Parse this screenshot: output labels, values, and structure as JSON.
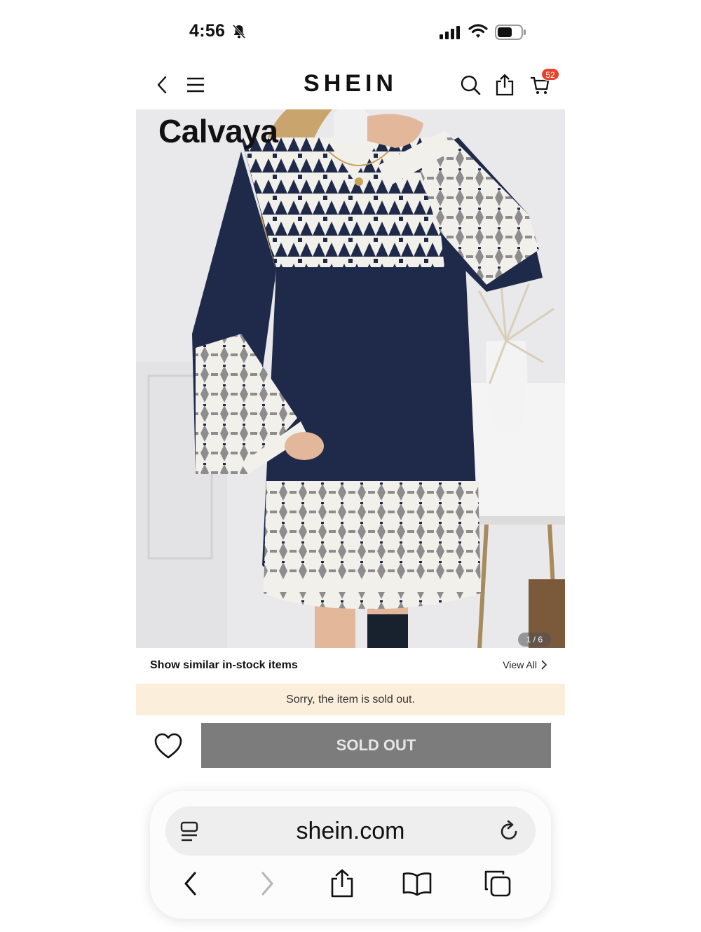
{
  "status_bar": {
    "time": "4:56"
  },
  "header": {
    "brand": "SHEIN",
    "cart_count": "52"
  },
  "product": {
    "image_brand": "Calvaya",
    "image_counter": "1 / 6"
  },
  "similar": {
    "title": "Show similar in-stock items",
    "view_all": "View All"
  },
  "notice": {
    "text": "Sorry, the item is sold out."
  },
  "actions": {
    "sold_out_label": "SOLD OUT"
  },
  "browser": {
    "url": "shein.com"
  },
  "colors": {
    "badge": "#e8412c",
    "notice_bg": "#fbeedb",
    "sold_out_button": "#7c7c7c",
    "dress_navy": "#1f2a4a"
  }
}
